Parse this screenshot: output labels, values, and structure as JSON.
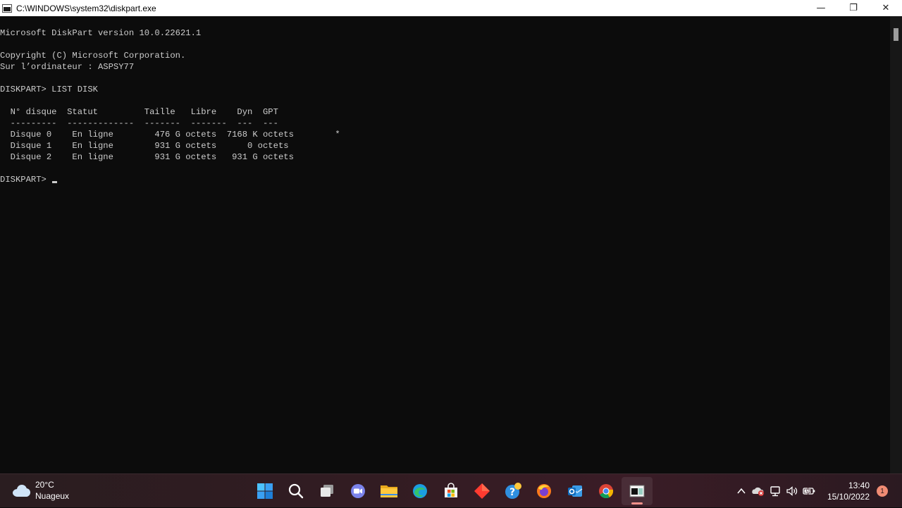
{
  "window": {
    "title": "C:\\WINDOWS\\system32\\diskpart.exe",
    "controls": {
      "minimize": "—",
      "restore": "❐",
      "close": "✕"
    }
  },
  "console": {
    "version_line": "Microsoft DiskPart version 10.0.22621.1",
    "copyright_line": "Copyright (C) Microsoft Corporation.",
    "computer_line": "Sur l’ordinateur : ASPSY77",
    "command_line": "DISKPART> LIST DISK",
    "table": {
      "header": "  N° disque  Statut         Taille   Libre    Dyn  GPT",
      "separator": "  ---------  -------------  -------  -------  ---  ---",
      "rows": [
        "  Disque 0    En ligne        476 G octets  7168 K octets        *",
        "  Disque 1    En ligne        931 G octets      0 octets",
        "  Disque 2    En ligne        931 G octets   931 G octets"
      ]
    },
    "prompt": "DISKPART> "
  },
  "taskbar": {
    "weather": {
      "temperature": "20°C",
      "condition": "Nuageux"
    },
    "apps": [
      "start-icon",
      "search-icon",
      "task-view-icon",
      "teams-chat-icon",
      "file-explorer-icon",
      "edge-icon",
      "store-icon",
      "red-diamond-app-icon",
      "help-icon",
      "firefox-icon",
      "outlook-icon",
      "chrome-icon",
      "terminal-icon"
    ],
    "clock": {
      "time": "13:40",
      "date": "15/10/2022"
    },
    "notifications": "1"
  },
  "colors": {
    "console_bg": "#0c0c0c",
    "console_fg": "#cccccc",
    "accent": "#f0908a"
  }
}
